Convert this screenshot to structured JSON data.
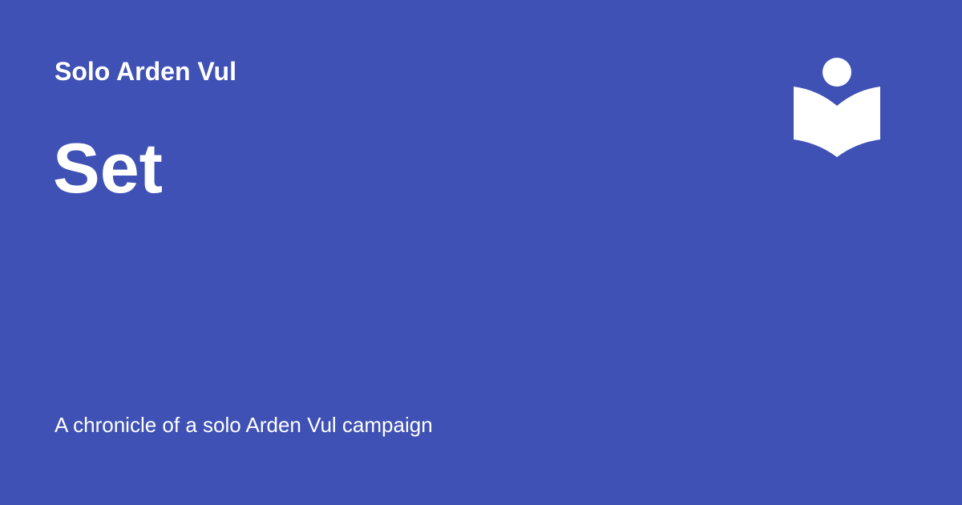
{
  "site": {
    "name": "Solo Arden Vul"
  },
  "page": {
    "title": "Set",
    "description": "A chronicle of a solo Arden Vul campaign"
  },
  "logo": {
    "icon": "reader-book-icon"
  },
  "colors": {
    "background": "#3f51b5",
    "foreground": "#ffffff"
  }
}
